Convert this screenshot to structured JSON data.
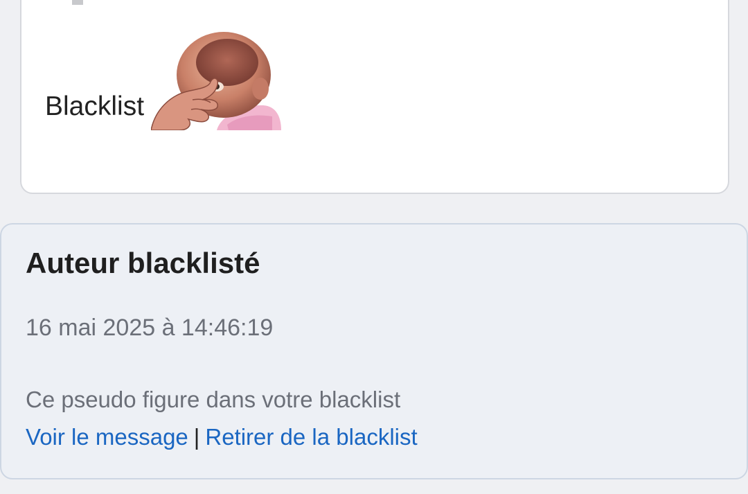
{
  "post": {
    "text": "Blacklist",
    "sticker_icon": "facepalm-baby-sticker"
  },
  "notice": {
    "title": "Auteur blacklisté",
    "date": "16 mai 2025 à 14:46:19",
    "description": "Ce pseudo figure dans votre blacklist",
    "view_link": "Voir le message",
    "separator": "|",
    "remove_link": "Retirer de la blacklist"
  },
  "colors": {
    "link": "#1a66c2",
    "notice_bg": "#edf0f5",
    "page_bg": "#eff0f3"
  }
}
